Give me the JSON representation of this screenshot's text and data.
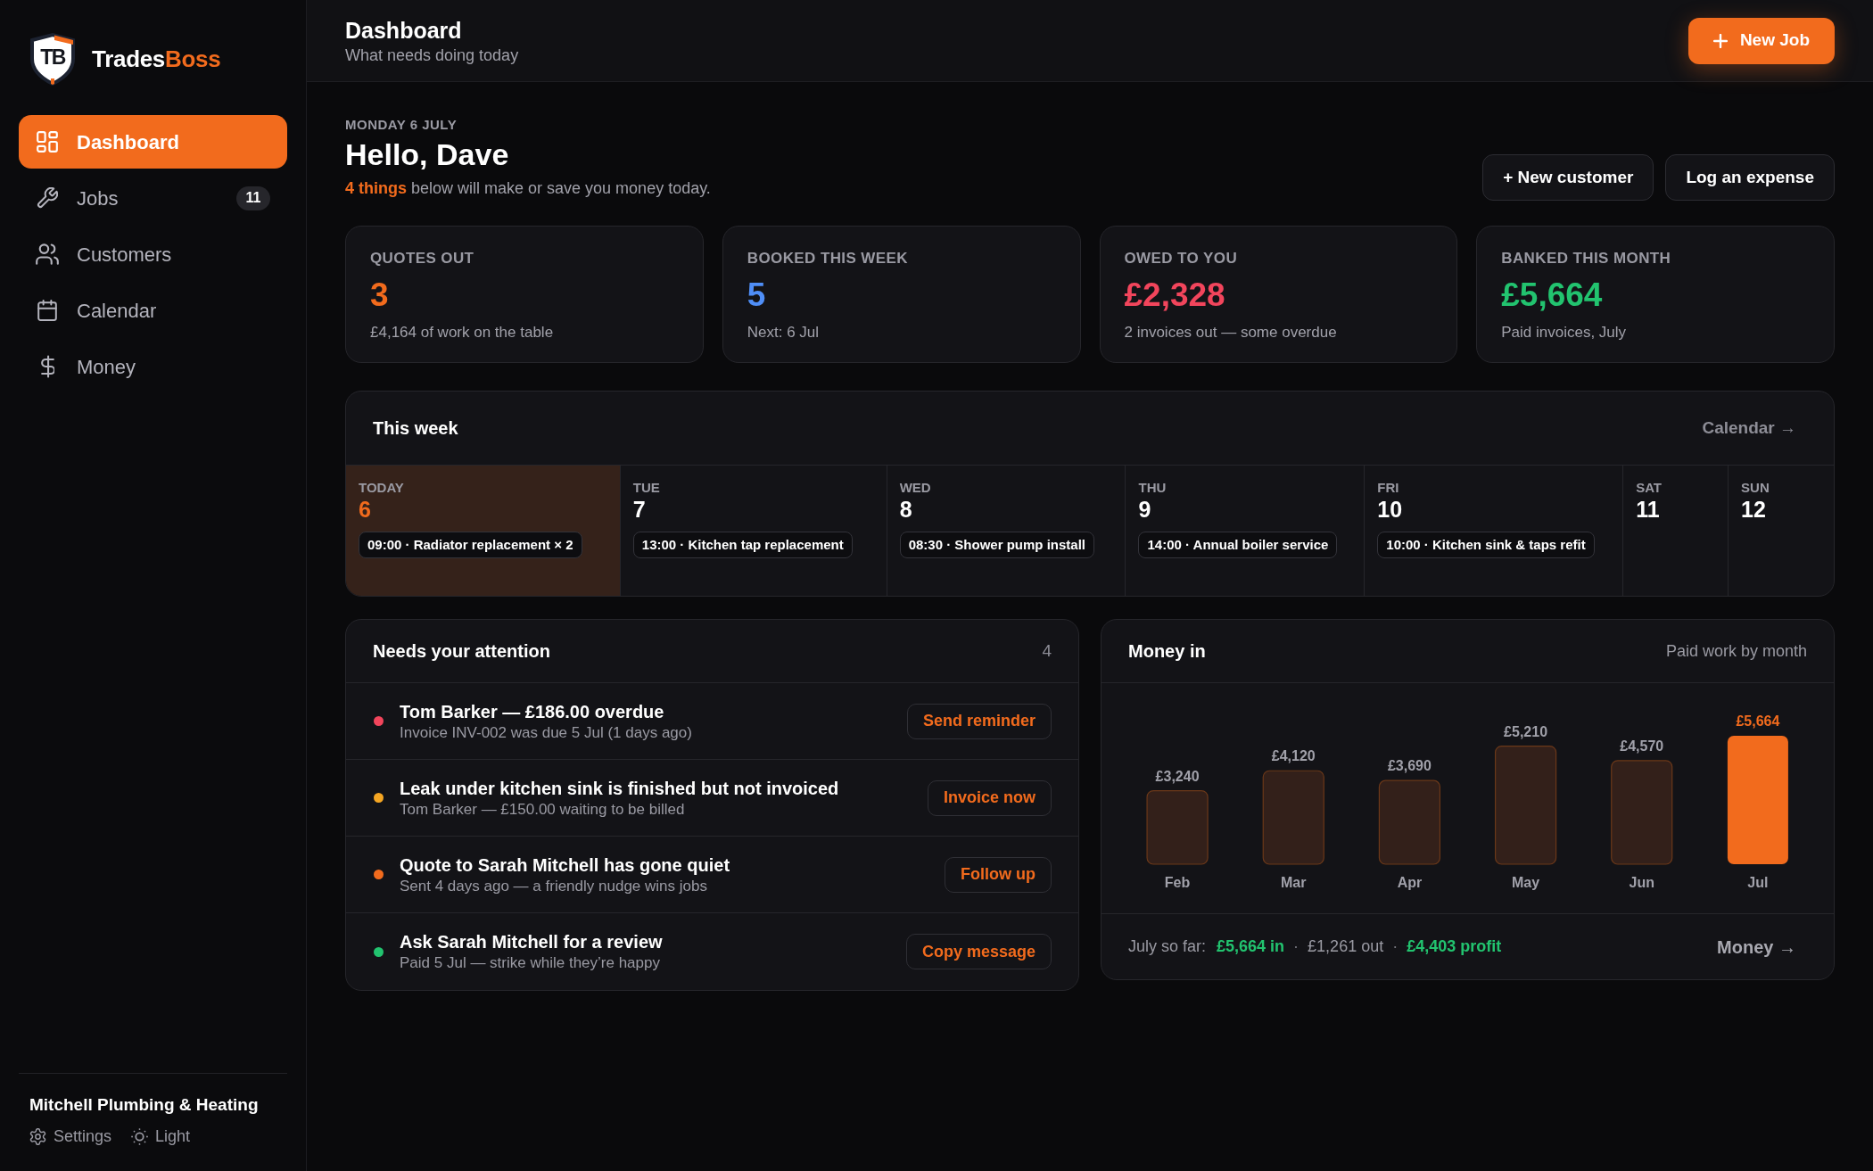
{
  "sidebar": {
    "brand": {
      "mark": "TB",
      "name": "Trades",
      "name_accent": "Boss"
    },
    "nav": [
      {
        "label": "Dashboard",
        "selected": true
      },
      {
        "label": "Jobs",
        "selected": false,
        "badge": "11"
      },
      {
        "label": "Customers",
        "selected": false
      },
      {
        "label": "Calendar",
        "selected": false
      },
      {
        "label": "Money",
        "selected": false
      }
    ],
    "business_name": "Mitchell Plumbing & Heating",
    "footer_links": [
      {
        "label": "Settings"
      },
      {
        "label": "Light"
      }
    ]
  },
  "header": {
    "title": "Dashboard",
    "subtitle": "What needs doing today",
    "primary_action": "New Job"
  },
  "greeting": {
    "date": "MONDAY 6 JULY",
    "title": "Hello, Dave",
    "summary": "**4 things** below will make or save you money today.",
    "actions": [
      "+ New customer",
      "Log an expense"
    ]
  },
  "stats": [
    {
      "label": "QUOTES OUT",
      "value": "3",
      "color": "#f26b1d",
      "detail": "£4,164 of work on the table"
    },
    {
      "label": "BOOKED THIS WEEK",
      "value": "5",
      "color": "#4f8ef7",
      "detail": "Next: 6 Jul"
    },
    {
      "label": "OWED TO YOU",
      "value": "£2,328",
      "color": "#f2455c",
      "detail": "2 invoices out — some overdue"
    },
    {
      "label": "BANKED THIS MONTH",
      "value": "£5,664",
      "color": "#22c36f",
      "detail": "Paid invoices, July"
    }
  ],
  "this_week": {
    "title": "This week",
    "link": "Calendar →",
    "days": [
      {
        "label": "TODAY",
        "date": "6",
        "today": true,
        "events": [
          "09:00 · Radiator replacement × 2"
        ]
      },
      {
        "label": "TUE",
        "date": "7",
        "today": false,
        "events": [
          "13:00 · Kitchen tap replacement"
        ]
      },
      {
        "label": "WED",
        "date": "8",
        "today": false,
        "events": [
          "08:30 · Shower pump install"
        ]
      },
      {
        "label": "THU",
        "date": "9",
        "today": false,
        "events": [
          "14:00 · Annual boiler service"
        ]
      },
      {
        "label": "FRI",
        "date": "10",
        "today": false,
        "events": [
          "10:00 · Kitchen sink & taps refit"
        ]
      },
      {
        "label": "SAT",
        "date": "11",
        "today": false
      },
      {
        "label": "SUN",
        "date": "12",
        "today": false
      }
    ]
  },
  "attention": {
    "title": "Needs your attention",
    "count": "4",
    "items": [
      {
        "color": "#f2455c",
        "title": "Tom Barker — £186.00 overdue",
        "detail": "Invoice INV-002 was due 5 Jul (1 days ago)",
        "action": "Send reminder"
      },
      {
        "color": "#f5a623",
        "title": "Leak under kitchen sink is finished but not invoiced",
        "detail": "Tom Barker — £150.00 waiting to be billed",
        "action": "Invoice now"
      },
      {
        "color": "#f26b1d",
        "title": "Quote to Sarah Mitchell has gone quiet",
        "detail": "Sent 4 days ago — a friendly nudge wins jobs",
        "action": "Follow up"
      },
      {
        "color": "#22c36f",
        "title": "Ask Sarah Mitchell for a review",
        "detail": "Paid 5 Jul — strike while they’re happy",
        "action": "Copy message"
      }
    ]
  },
  "money_in": {
    "title": "Money in",
    "subtitle": "Paid work by month",
    "chart_data": {
      "type": "bar",
      "categories": [
        "Feb",
        "Mar",
        "Apr",
        "May",
        "Jun",
        "Jul"
      ],
      "values": [
        3240,
        4120,
        3690,
        5210,
        4570,
        5664
      ],
      "value_labels": [
        "£3,240",
        "£4,120",
        "£3,690",
        "£5,210",
        "£4,570",
        "£5,664"
      ],
      "annotations": [
        {
          "x": "Jul"
        }
      ]
    },
    "footer": {
      "label": "July so far:",
      "figures": [
        {
          "kind": "positive",
          "text": "£5,664 in"
        },
        {
          "kind": "separator",
          "text": "·"
        },
        {
          "kind": "neutral",
          "text": "£1,261 out"
        },
        {
          "kind": "separator",
          "text": "·"
        },
        {
          "kind": "positive",
          "text": "£4,403 profit"
        }
      ],
      "link": "Money →"
    }
  }
}
